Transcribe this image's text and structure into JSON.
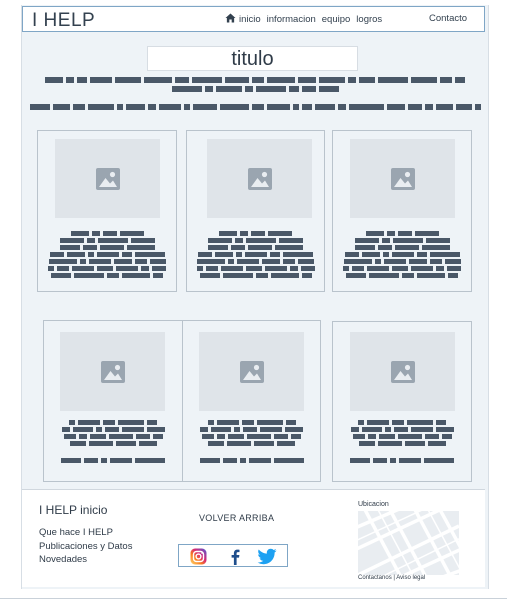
{
  "header": {
    "logo": "I HELP",
    "nav": [
      "inicio",
      "informacion",
      "equipo",
      "logros"
    ],
    "contact": "Contacto"
  },
  "hero": {
    "title": "titulo"
  },
  "cards": [
    {
      "image": "image-placeholder-icon"
    },
    {
      "image": "image-placeholder-icon"
    },
    {
      "image": "image-placeholder-icon"
    },
    {
      "image": "image-placeholder-icon"
    },
    {
      "image": "image-placeholder-icon"
    },
    {
      "image": "image-placeholder-icon"
    }
  ],
  "footer": {
    "title": "I HELP inicio",
    "links": [
      "Que hace I HELP",
      "Publicaciones y Datos",
      "Novedades"
    ],
    "back_to_top": "VOLVER ARRIBA",
    "social": [
      "instagram-icon",
      "facebook-icon",
      "twitter-icon"
    ],
    "location_label": "Ubicacion",
    "legal": "Contactanos | Aviso legal"
  },
  "colors": {
    "page_background": "#eef3f7",
    "placeholder_text_bars": "#4a5868",
    "header_border": "#7fa6c6",
    "instagram": "#d6249f",
    "facebook": "#1f4e8c",
    "twitter": "#1da1f2"
  }
}
